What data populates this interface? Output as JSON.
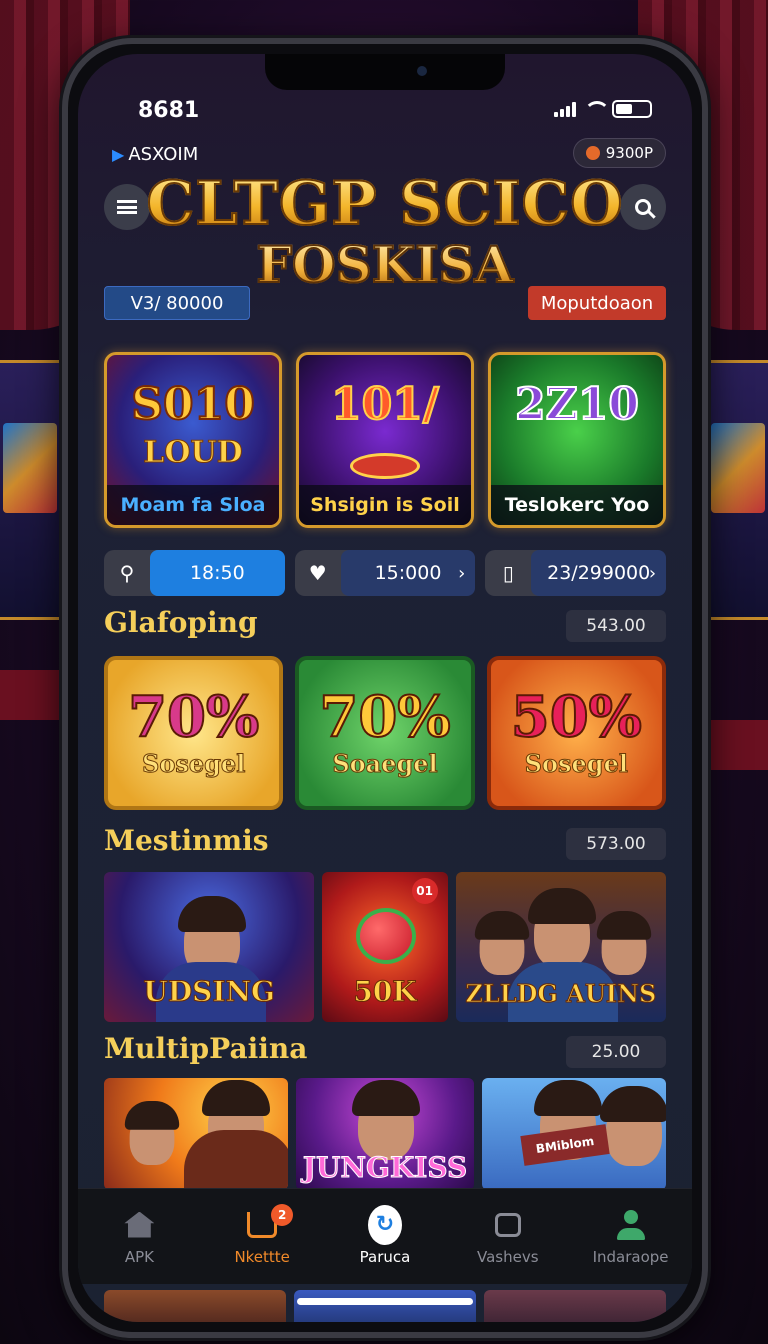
{
  "status": {
    "time": "8681"
  },
  "header": {
    "brand": "ASXOIM",
    "coin_balance": "9300P",
    "title_line1": "CLTGP SCICO",
    "title_line2": "FOSKISA",
    "left_pill": "V3/ 80000",
    "right_pill": "Moputdoaon"
  },
  "featured": [
    {
      "big": "S010",
      "sub": "LOUD",
      "label": "Moam fa Sloa"
    },
    {
      "big": "101/",
      "sub": "",
      "label": "Shsigin is Soil"
    },
    {
      "big": "2Z10",
      "sub": "",
      "label": "Teslokerc Yoo"
    }
  ],
  "stats": [
    {
      "icon": "search-icon",
      "value": "18:50"
    },
    {
      "icon": "heart-icon",
      "value": "15:000"
    },
    {
      "icon": "ticket-icon",
      "value": "23/299000"
    }
  ],
  "section1": {
    "title": "Glafoping",
    "value": "543.00"
  },
  "bonuses": [
    {
      "pct": "70%",
      "label": "Sosegel",
      "color": "#e8a62a"
    },
    {
      "pct": "70%",
      "label": "Soaegel",
      "color": "#2a8a36"
    },
    {
      "pct": "50%",
      "label": "Sosegel",
      "color": "#d8561a"
    }
  ],
  "section2": {
    "title": "Mestinmis",
    "value": "573.00",
    "tiles": [
      {
        "title": "UDSING"
      },
      {
        "title": "50K",
        "badge": "01"
      },
      {
        "title": "ZLLDG AUINS"
      }
    ]
  },
  "section3": {
    "title": "MultipPaiina",
    "value": "25.00",
    "tiles": [
      {
        "title": ""
      },
      {
        "title": "JUNGKISS"
      },
      {
        "title": "BMiblom"
      }
    ]
  },
  "nav": [
    {
      "label": "APK",
      "icon": "home-icon"
    },
    {
      "label": "Nkettte",
      "icon": "cart-icon",
      "badge": "2"
    },
    {
      "label": "Paruca",
      "icon": "refresh-icon"
    },
    {
      "label": "Vashevs",
      "icon": "bag-icon"
    },
    {
      "label": "Indaraope",
      "icon": "profile-icon"
    }
  ]
}
